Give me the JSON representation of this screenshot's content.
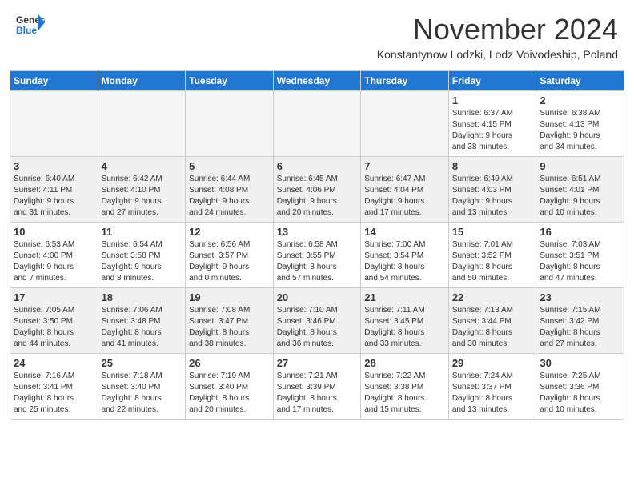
{
  "header": {
    "logo_line1": "General",
    "logo_line2": "Blue",
    "month_title": "November 2024",
    "subtitle": "Konstantynow Lodzki, Lodz Voivodeship, Poland"
  },
  "days_of_week": [
    "Sunday",
    "Monday",
    "Tuesday",
    "Wednesday",
    "Thursday",
    "Friday",
    "Saturday"
  ],
  "weeks": [
    {
      "shade": false,
      "days": [
        {
          "num": "",
          "info": ""
        },
        {
          "num": "",
          "info": ""
        },
        {
          "num": "",
          "info": ""
        },
        {
          "num": "",
          "info": ""
        },
        {
          "num": "",
          "info": ""
        },
        {
          "num": "1",
          "info": "Sunrise: 6:37 AM\nSunset: 4:15 PM\nDaylight: 9 hours\nand 38 minutes."
        },
        {
          "num": "2",
          "info": "Sunrise: 6:38 AM\nSunset: 4:13 PM\nDaylight: 9 hours\nand 34 minutes."
        }
      ]
    },
    {
      "shade": true,
      "days": [
        {
          "num": "3",
          "info": "Sunrise: 6:40 AM\nSunset: 4:11 PM\nDaylight: 9 hours\nand 31 minutes."
        },
        {
          "num": "4",
          "info": "Sunrise: 6:42 AM\nSunset: 4:10 PM\nDaylight: 9 hours\nand 27 minutes."
        },
        {
          "num": "5",
          "info": "Sunrise: 6:44 AM\nSunset: 4:08 PM\nDaylight: 9 hours\nand 24 minutes."
        },
        {
          "num": "6",
          "info": "Sunrise: 6:45 AM\nSunset: 4:06 PM\nDaylight: 9 hours\nand 20 minutes."
        },
        {
          "num": "7",
          "info": "Sunrise: 6:47 AM\nSunset: 4:04 PM\nDaylight: 9 hours\nand 17 minutes."
        },
        {
          "num": "8",
          "info": "Sunrise: 6:49 AM\nSunset: 4:03 PM\nDaylight: 9 hours\nand 13 minutes."
        },
        {
          "num": "9",
          "info": "Sunrise: 6:51 AM\nSunset: 4:01 PM\nDaylight: 9 hours\nand 10 minutes."
        }
      ]
    },
    {
      "shade": false,
      "days": [
        {
          "num": "10",
          "info": "Sunrise: 6:53 AM\nSunset: 4:00 PM\nDaylight: 9 hours\nand 7 minutes."
        },
        {
          "num": "11",
          "info": "Sunrise: 6:54 AM\nSunset: 3:58 PM\nDaylight: 9 hours\nand 3 minutes."
        },
        {
          "num": "12",
          "info": "Sunrise: 6:56 AM\nSunset: 3:57 PM\nDaylight: 9 hours\nand 0 minutes."
        },
        {
          "num": "13",
          "info": "Sunrise: 6:58 AM\nSunset: 3:55 PM\nDaylight: 8 hours\nand 57 minutes."
        },
        {
          "num": "14",
          "info": "Sunrise: 7:00 AM\nSunset: 3:54 PM\nDaylight: 8 hours\nand 54 minutes."
        },
        {
          "num": "15",
          "info": "Sunrise: 7:01 AM\nSunset: 3:52 PM\nDaylight: 8 hours\nand 50 minutes."
        },
        {
          "num": "16",
          "info": "Sunrise: 7:03 AM\nSunset: 3:51 PM\nDaylight: 8 hours\nand 47 minutes."
        }
      ]
    },
    {
      "shade": true,
      "days": [
        {
          "num": "17",
          "info": "Sunrise: 7:05 AM\nSunset: 3:50 PM\nDaylight: 8 hours\nand 44 minutes."
        },
        {
          "num": "18",
          "info": "Sunrise: 7:06 AM\nSunset: 3:48 PM\nDaylight: 8 hours\nand 41 minutes."
        },
        {
          "num": "19",
          "info": "Sunrise: 7:08 AM\nSunset: 3:47 PM\nDaylight: 8 hours\nand 38 minutes."
        },
        {
          "num": "20",
          "info": "Sunrise: 7:10 AM\nSunset: 3:46 PM\nDaylight: 8 hours\nand 36 minutes."
        },
        {
          "num": "21",
          "info": "Sunrise: 7:11 AM\nSunset: 3:45 PM\nDaylight: 8 hours\nand 33 minutes."
        },
        {
          "num": "22",
          "info": "Sunrise: 7:13 AM\nSunset: 3:44 PM\nDaylight: 8 hours\nand 30 minutes."
        },
        {
          "num": "23",
          "info": "Sunrise: 7:15 AM\nSunset: 3:42 PM\nDaylight: 8 hours\nand 27 minutes."
        }
      ]
    },
    {
      "shade": false,
      "days": [
        {
          "num": "24",
          "info": "Sunrise: 7:16 AM\nSunset: 3:41 PM\nDaylight: 8 hours\nand 25 minutes."
        },
        {
          "num": "25",
          "info": "Sunrise: 7:18 AM\nSunset: 3:40 PM\nDaylight: 8 hours\nand 22 minutes."
        },
        {
          "num": "26",
          "info": "Sunrise: 7:19 AM\nSunset: 3:40 PM\nDaylight: 8 hours\nand 20 minutes."
        },
        {
          "num": "27",
          "info": "Sunrise: 7:21 AM\nSunset: 3:39 PM\nDaylight: 8 hours\nand 17 minutes."
        },
        {
          "num": "28",
          "info": "Sunrise: 7:22 AM\nSunset: 3:38 PM\nDaylight: 8 hours\nand 15 minutes."
        },
        {
          "num": "29",
          "info": "Sunrise: 7:24 AM\nSunset: 3:37 PM\nDaylight: 8 hours\nand 13 minutes."
        },
        {
          "num": "30",
          "info": "Sunrise: 7:25 AM\nSunset: 3:36 PM\nDaylight: 8 hours\nand 10 minutes."
        }
      ]
    }
  ]
}
